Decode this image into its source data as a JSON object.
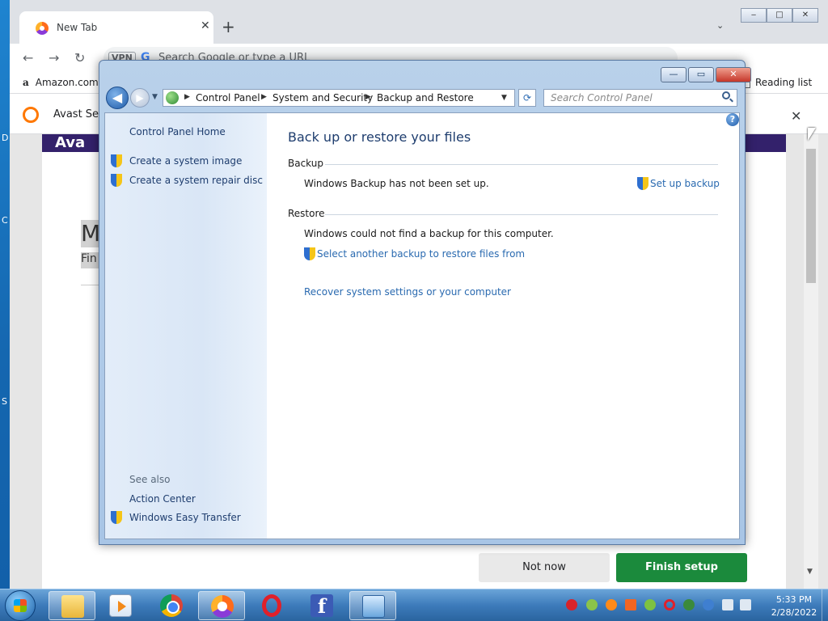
{
  "browser": {
    "tab_title": "New Tab",
    "tab_close": "✕",
    "new_tab": "+",
    "tab_search": "⌄",
    "win_min": "‒",
    "win_max": "□",
    "win_close": "✕",
    "back": "←",
    "forward": "→",
    "reload": "↻",
    "vpn_label": "VPN",
    "google_g": "G",
    "omnibox_placeholder": "Search Google or type a URL",
    "bookmark_amazon": "Amazon.com",
    "bookmark_amazon_glyph": "a",
    "reading_list": "Reading list",
    "avast_notice": "Avast Secu",
    "avast_close": "✕",
    "page_brand": "Ava",
    "page_heading_fragment": "M",
    "page_sub_fragment": "Fin",
    "not_now": "Not now",
    "finish_setup": "Finish setup",
    "scroll_down": "▼"
  },
  "control_panel": {
    "caption": {
      "minimize": "—",
      "maximize": "▭",
      "close": "✕"
    },
    "nav": {
      "back": "◀",
      "forward": "▶",
      "history": "▼",
      "breadcrumbs": [
        "Control Panel",
        "System and Security",
        "Backup and Restore"
      ],
      "crumb_sep": "▶",
      "address_drop": "▼",
      "refresh": "⟳",
      "search_placeholder": "Search Control Panel"
    },
    "left_pane": {
      "home": "Control Panel Home",
      "tasks": [
        "Create a system image",
        "Create a system repair disc"
      ],
      "see_also_label": "See also",
      "see_also": [
        "Action Center",
        "Windows Easy Transfer"
      ]
    },
    "help": "?",
    "main": {
      "title": "Back up or restore your files",
      "backup_label": "Backup",
      "backup_status": "Windows Backup has not been set up.",
      "setup_link": "Set up backup",
      "restore_label": "Restore",
      "restore_status": "Windows could not find a backup for this computer.",
      "select_backup_link": "Select another backup to restore files from",
      "recover_link": "Recover system settings or your computer"
    }
  },
  "taskbar": {
    "facebook_glyph": "f",
    "clock_time": "5:33 PM",
    "clock_date": "2/28/2022"
  },
  "desktop": {
    "edge_letters": [
      "D",
      "C",
      "S"
    ]
  },
  "colors": {
    "link": "#2a6ab0",
    "finish_button": "#1b8a3c",
    "avast_purple": "#33216b"
  }
}
